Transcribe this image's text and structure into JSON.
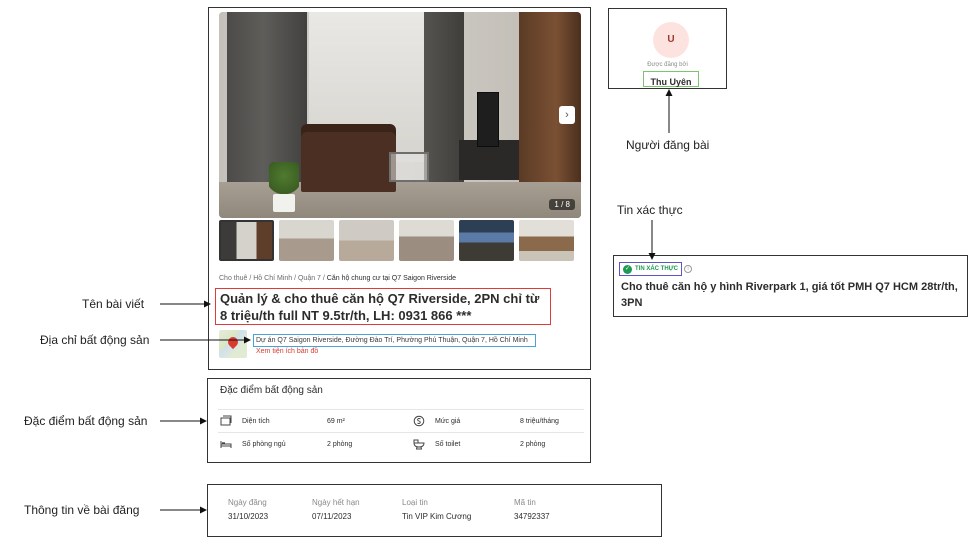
{
  "listing": {
    "photo_counter": "1 / 8",
    "next_glyph": "›",
    "breadcrumb": {
      "path": "Cho thuê / Hồ Chí Minh / Quận 7 / ",
      "current": "Căn hộ chung cư tại Q7 Saigon Riverside"
    },
    "title": "Quản lý & cho thuê căn hộ Q7 Riverside, 2PN chỉ từ 8 triệu/th full NT 9.5tr/th, LH: 0931 866 ***",
    "address": "Dự án Q7 Saigon Riverside, Đường Đào Trí, Phường Phú Thuận, Quận 7, Hồ Chí Minh",
    "map_link": "Xem tiện ích bản đồ"
  },
  "features": {
    "title": "Đặc điểm bất động sản",
    "items": [
      {
        "icon": "area-icon",
        "label": "Diện tích",
        "value": "69 m²"
      },
      {
        "icon": "price-icon",
        "label": "Mức giá",
        "value": "8 triệu/tháng"
      },
      {
        "icon": "bed-icon",
        "label": "Số phòng ngủ",
        "value": "2 phòng"
      },
      {
        "icon": "toilet-icon",
        "label": "Số toilet",
        "value": "2 phòng"
      }
    ]
  },
  "post_info": {
    "items": [
      {
        "label": "Ngày đăng",
        "value": "31/10/2023"
      },
      {
        "label": "Ngày hết hạn",
        "value": "07/11/2023"
      },
      {
        "label": "Loại tin",
        "value": "Tin VIP Kim Cương"
      },
      {
        "label": "Mã tin",
        "value": "34792337"
      }
    ]
  },
  "poster": {
    "avatar_initial": "U",
    "posted_by": "Được đăng bởi",
    "name": "Thu Uyên"
  },
  "verified": {
    "badge": "TIN XÁC THỰC",
    "info_glyph": "i",
    "check_glyph": "✓",
    "title": "Cho thuê căn hộ y hình Riverpark 1, giá tốt PMH Q7 HCM 28tr/th, 3PN"
  },
  "annotations": {
    "poster": "Người đăng bài",
    "verified": "Tin xác thực",
    "title": "Tên bài viết",
    "address": "Địa chỉ bất động sản",
    "features": "Đặc điểm bất động sản",
    "post_info": "Thông tin về bài đăng"
  },
  "colors": {
    "title_highlight": "#e03b3b",
    "address_highlight": "#4aa3d8",
    "poster_highlight": "#7cc46e",
    "badge_highlight": "#5b55c7",
    "verified_green": "#1e9b52",
    "link_red": "#d93a2e"
  }
}
